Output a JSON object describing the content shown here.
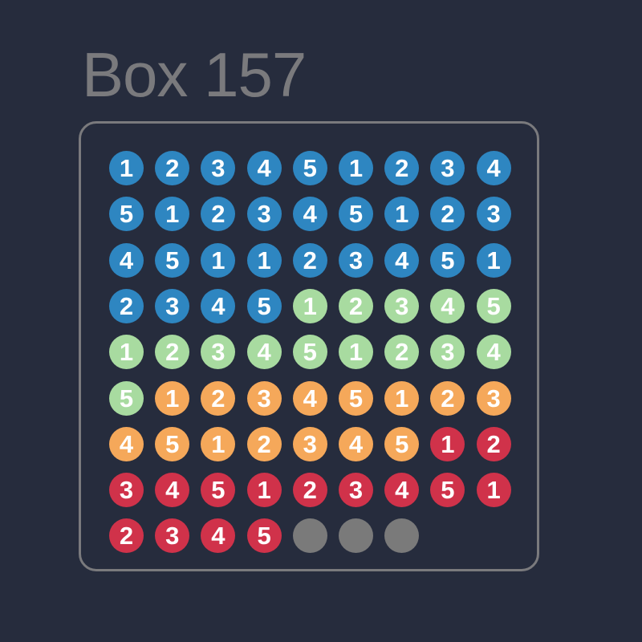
{
  "title": "Box 157",
  "colors": {
    "background": "#262c3d",
    "title_text": "#7a7a7d",
    "frame_border": "#7a7a7d",
    "blue": "#2e86c1",
    "green": "#a8dba0",
    "orange": "#f5a85a",
    "red": "#d0324a",
    "empty": "#7a7a7a",
    "number_text": "#ffffff"
  },
  "columns": 9,
  "slots": [
    {
      "n": "1",
      "c": "blue"
    },
    {
      "n": "2",
      "c": "blue"
    },
    {
      "n": "3",
      "c": "blue"
    },
    {
      "n": "4",
      "c": "blue"
    },
    {
      "n": "5",
      "c": "blue"
    },
    {
      "n": "1",
      "c": "blue"
    },
    {
      "n": "2",
      "c": "blue"
    },
    {
      "n": "3",
      "c": "blue"
    },
    {
      "n": "4",
      "c": "blue"
    },
    {
      "n": "5",
      "c": "blue"
    },
    {
      "n": "1",
      "c": "blue"
    },
    {
      "n": "2",
      "c": "blue"
    },
    {
      "n": "3",
      "c": "blue"
    },
    {
      "n": "4",
      "c": "blue"
    },
    {
      "n": "5",
      "c": "blue"
    },
    {
      "n": "1",
      "c": "blue"
    },
    {
      "n": "2",
      "c": "blue"
    },
    {
      "n": "3",
      "c": "blue"
    },
    {
      "n": "4",
      "c": "blue"
    },
    {
      "n": "5",
      "c": "blue"
    },
    {
      "n": "1",
      "c": "blue"
    },
    {
      "n": "1",
      "c": "blue"
    },
    {
      "n": "2",
      "c": "blue"
    },
    {
      "n": "3",
      "c": "blue"
    },
    {
      "n": "4",
      "c": "blue"
    },
    {
      "n": "5",
      "c": "blue"
    },
    {
      "n": "1",
      "c": "blue"
    },
    {
      "n": "2",
      "c": "blue"
    },
    {
      "n": "3",
      "c": "blue"
    },
    {
      "n": "4",
      "c": "blue"
    },
    {
      "n": "5",
      "c": "blue"
    },
    {
      "n": "1",
      "c": "green"
    },
    {
      "n": "2",
      "c": "green"
    },
    {
      "n": "3",
      "c": "green"
    },
    {
      "n": "4",
      "c": "green"
    },
    {
      "n": "5",
      "c": "green"
    },
    {
      "n": "1",
      "c": "green"
    },
    {
      "n": "2",
      "c": "green"
    },
    {
      "n": "3",
      "c": "green"
    },
    {
      "n": "4",
      "c": "green"
    },
    {
      "n": "5",
      "c": "green"
    },
    {
      "n": "1",
      "c": "green"
    },
    {
      "n": "2",
      "c": "green"
    },
    {
      "n": "3",
      "c": "green"
    },
    {
      "n": "4",
      "c": "green"
    },
    {
      "n": "5",
      "c": "green"
    },
    {
      "n": "1",
      "c": "orange"
    },
    {
      "n": "2",
      "c": "orange"
    },
    {
      "n": "3",
      "c": "orange"
    },
    {
      "n": "4",
      "c": "orange"
    },
    {
      "n": "5",
      "c": "orange"
    },
    {
      "n": "1",
      "c": "orange"
    },
    {
      "n": "2",
      "c": "orange"
    },
    {
      "n": "3",
      "c": "orange"
    },
    {
      "n": "4",
      "c": "orange"
    },
    {
      "n": "5",
      "c": "orange"
    },
    {
      "n": "1",
      "c": "orange"
    },
    {
      "n": "2",
      "c": "orange"
    },
    {
      "n": "3",
      "c": "orange"
    },
    {
      "n": "4",
      "c": "orange"
    },
    {
      "n": "5",
      "c": "orange"
    },
    {
      "n": "1",
      "c": "red"
    },
    {
      "n": "2",
      "c": "red"
    },
    {
      "n": "3",
      "c": "red"
    },
    {
      "n": "4",
      "c": "red"
    },
    {
      "n": "5",
      "c": "red"
    },
    {
      "n": "1",
      "c": "red"
    },
    {
      "n": "2",
      "c": "red"
    },
    {
      "n": "3",
      "c": "red"
    },
    {
      "n": "4",
      "c": "red"
    },
    {
      "n": "5",
      "c": "red"
    },
    {
      "n": "1",
      "c": "red"
    },
    {
      "n": "2",
      "c": "red"
    },
    {
      "n": "3",
      "c": "red"
    },
    {
      "n": "4",
      "c": "red"
    },
    {
      "n": "5",
      "c": "red"
    },
    {
      "n": "",
      "c": "empty"
    },
    {
      "n": "",
      "c": "empty"
    },
    {
      "n": "",
      "c": "empty"
    }
  ]
}
